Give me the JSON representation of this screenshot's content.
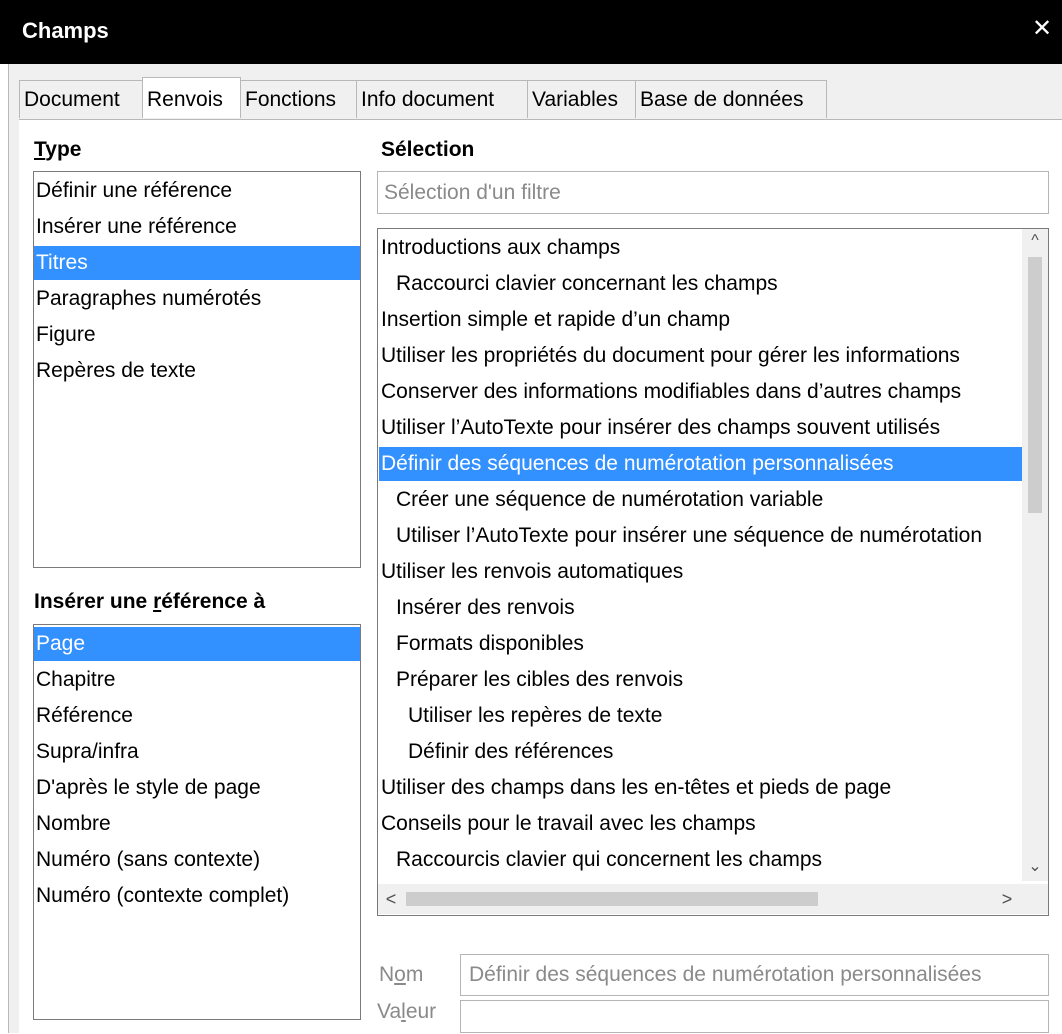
{
  "window": {
    "title": "Champs",
    "close_glyph": "✕"
  },
  "tabs": [
    {
      "label": "Document"
    },
    {
      "label": "Renvois"
    },
    {
      "label": "Fonctions"
    },
    {
      "label": "Info document"
    },
    {
      "label": "Variables"
    },
    {
      "label": "Base de données"
    }
  ],
  "type_section": {
    "heading_first": "T",
    "heading_rest": "ype",
    "items": [
      "Définir une référence",
      "Insérer une référence",
      "Titres",
      "Paragraphes numérotés",
      "Figure",
      "Repères de texte"
    ],
    "selected": "Titres"
  },
  "insert_ref_section": {
    "heading_pre": "Insérer une ",
    "heading_u": "r",
    "heading_post": "éférence à",
    "items": [
      "Page",
      "Chapitre",
      "Référence",
      "Supra/infra",
      "D'après le style de page",
      "Nombre",
      "Numéro (sans contexte)",
      "Numéro (contexte complet)"
    ],
    "selected": "Page"
  },
  "selection_section": {
    "heading": "Sélection",
    "filter_placeholder": "Sélection d'un filtre",
    "items": [
      "Introductions aux champs",
      "Raccourci clavier concernant les champs",
      "Insertion simple et rapide d’un champ",
      "Utiliser les propriétés du document pour gérer les informations",
      "Conserver des informations modifiables dans d’autres champs",
      "Utiliser l’AutoTexte pour insérer des champs souvent utilisés",
      "Définir des séquences de numérotation personnalisées",
      "Créer une séquence de numérotation variable",
      "Utiliser l’AutoTexte pour insérer une séquence de numérotation",
      "Utiliser les renvois automatiques",
      "Insérer des renvois",
      "Formats disponibles",
      "Préparer les cibles des renvois",
      "Utiliser les repères de texte",
      "Définir des références",
      "Utiliser des champs dans les en-têtes et pieds de page",
      "Conseils pour le travail avec les champs",
      "Raccourcis clavier qui concernent les champs"
    ],
    "selected": "Définir des séquences de numérotation personnalisées",
    "scroll_up": "^",
    "scroll_down": "⌄",
    "scroll_left": "<",
    "scroll_right": ">"
  },
  "name_field": {
    "label_pre": "N",
    "label_u": "o",
    "label_post": "m",
    "value": "Définir des séquences de numérotation personnalisées"
  },
  "value_field": {
    "label_pre": "Va",
    "label_u": "l",
    "label_post": "eur",
    "value": ""
  }
}
